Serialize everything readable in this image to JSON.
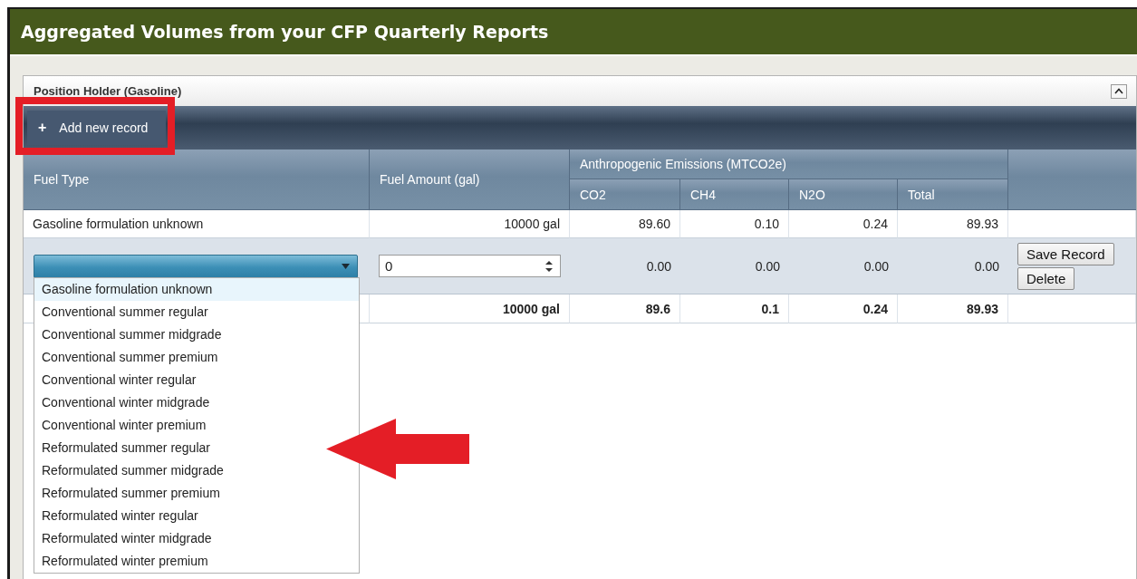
{
  "header": {
    "title": "Aggregated Volumes from your CFP Quarterly Reports"
  },
  "panel": {
    "title": "Position Holder (Gasoline)",
    "expanded": true
  },
  "toolbar": {
    "add_icon": "+",
    "add_label": "Add new record"
  },
  "table": {
    "columns": [
      "Fuel Type",
      "Fuel Amount (gal)"
    ],
    "group_header": "Anthropogenic Emissions (MTCO2e)",
    "subcolumns": [
      "CO2",
      "CH4",
      "N2O",
      "Total"
    ],
    "rows": [
      {
        "fuel_type": "Gasoline formulation unknown",
        "fuel_amount": "10000 gal",
        "values": [
          "89.60",
          "0.10",
          "0.24",
          "89.93"
        ]
      }
    ],
    "edit_row": {
      "fuel_amount": "0",
      "values": [
        "0.00",
        "0.00",
        "0.00",
        "0.00"
      ],
      "buttons": [
        "Save Record",
        "Delete"
      ]
    },
    "totals": {
      "fuel_amount": "10000 gal",
      "values": [
        "89.6",
        "0.1",
        "0.24",
        "89.93"
      ]
    }
  },
  "dropdown": {
    "expanded": true,
    "options": [
      {
        "label": "Gasoline formulation unknown",
        "selected": true
      },
      {
        "label": "Conventional summer regular",
        "selected": false
      },
      {
        "label": "Conventional summer midgrade",
        "selected": false
      },
      {
        "label": "Conventional summer premium",
        "selected": false
      },
      {
        "label": "Conventional winter regular",
        "selected": false
      },
      {
        "label": "Conventional winter midgrade",
        "selected": false
      },
      {
        "label": "Conventional winter premium",
        "selected": false
      },
      {
        "label": "Reformulated summer regular",
        "selected": false
      },
      {
        "label": "Reformulated summer midgrade",
        "selected": false
      },
      {
        "label": "Reformulated summer premium",
        "selected": false
      },
      {
        "label": "Reformulated winter regular",
        "selected": false
      },
      {
        "label": "Reformulated winter midgrade",
        "selected": false
      },
      {
        "label": "Reformulated winter premium",
        "selected": false
      }
    ]
  }
}
